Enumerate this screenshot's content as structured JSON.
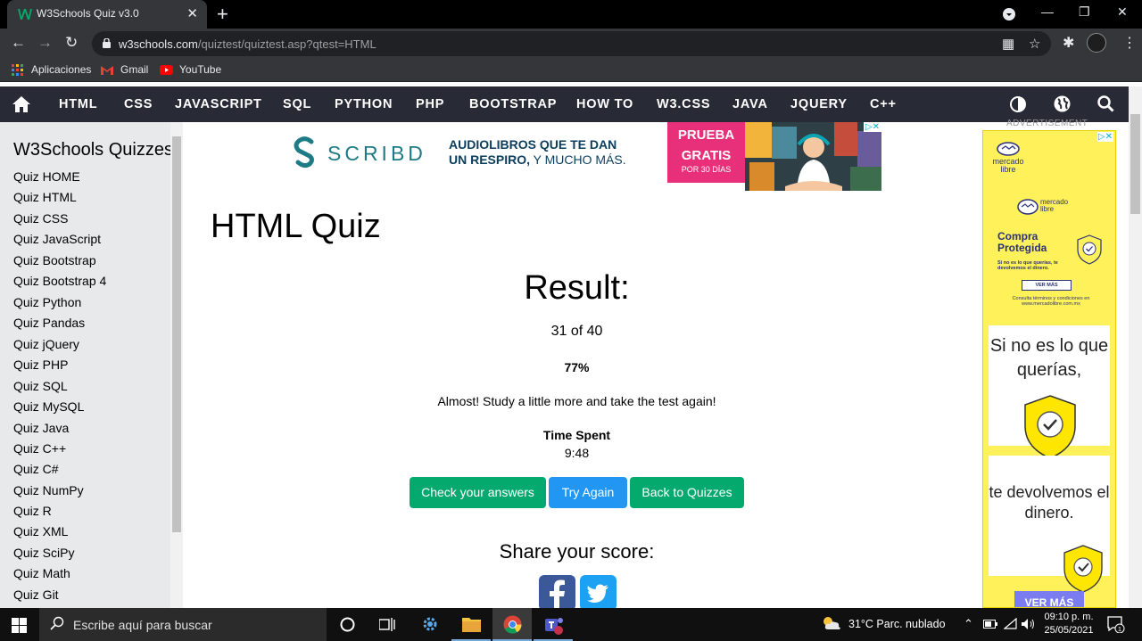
{
  "browser": {
    "tab_title": "W3Schools Quiz v3.0",
    "tab_close": "✕",
    "new_tab": "+",
    "url_host": "w3schools.com",
    "url_path": "/quiztest/quiztest.asp?qtest=HTML",
    "bookmarks": [
      {
        "label": "Aplicaciones"
      },
      {
        "label": "Gmail"
      },
      {
        "label": "YouTube"
      }
    ]
  },
  "w3nav": {
    "items": [
      "HTML",
      "CSS",
      "JAVASCRIPT",
      "SQL",
      "PYTHON",
      "PHP",
      "BOOTSTRAP",
      "HOW TO",
      "W3.CSS",
      "JAVA",
      "JQUERY",
      "C++"
    ]
  },
  "sidebar": {
    "title": "W3Schools Quizzes",
    "links": [
      "Quiz HOME",
      "Quiz HTML",
      "Quiz CSS",
      "Quiz JavaScript",
      "Quiz Bootstrap",
      "Quiz Bootstrap 4",
      "Quiz Python",
      "Quiz Pandas",
      "Quiz jQuery",
      "Quiz PHP",
      "Quiz SQL",
      "Quiz MySQL",
      "Quiz Java",
      "Quiz C++",
      "Quiz C#",
      "Quiz NumPy",
      "Quiz R",
      "Quiz XML",
      "Quiz SciPy",
      "Quiz Math",
      "Quiz Git"
    ]
  },
  "top_ad": {
    "brand": "SCRIBD",
    "line1": "AUDIOLIBROS QUE TE DAN",
    "line2_bold": "UN RESPIRO,",
    "line2_rest": " Y MUCHO MÁS.",
    "cta_line1": "PRUEBA",
    "cta_line2": "GRATIS",
    "cta_line3": "POR 30 DÍAS"
  },
  "main": {
    "page_title": "HTML Quiz",
    "result_heading": "Result:",
    "score": "31 of 40",
    "percent": "77%",
    "message": "Almost! Study a little more and take the test again!",
    "time_label": "Time Spent",
    "time_value": "9:48",
    "buttons": {
      "check": "Check your answers",
      "try": "Try Again",
      "back": "Back to Quizzes"
    },
    "share_label": "Share your score:"
  },
  "right_ad": {
    "label": "ADVERTISEMENT",
    "logo": "mercado libre",
    "card_title": "Compra Protegida",
    "card_small": "Si no es lo que querías, te devolvemos el dinero.",
    "card_button": "VER MÁS",
    "card_footer": "Consulta términos y condiciones en www.mercadolibre.com.mx",
    "panel1": "Si no es lo que querías,",
    "panel2": "te devolvemos el dinero.",
    "button": "VER MÁS"
  },
  "taskbar": {
    "search_placeholder": "Escribe aquí para buscar",
    "weather": "31°C  Parc. nublado",
    "time": "09:10 p. m.",
    "date": "25/05/2021"
  },
  "colors": {
    "w3_nav_bg": "#282a35",
    "w3_green": "#04aa6d",
    "w3_blue": "#2196f3",
    "sidebar_bg": "#e7e9eb",
    "ml_yellow": "#fff159"
  }
}
